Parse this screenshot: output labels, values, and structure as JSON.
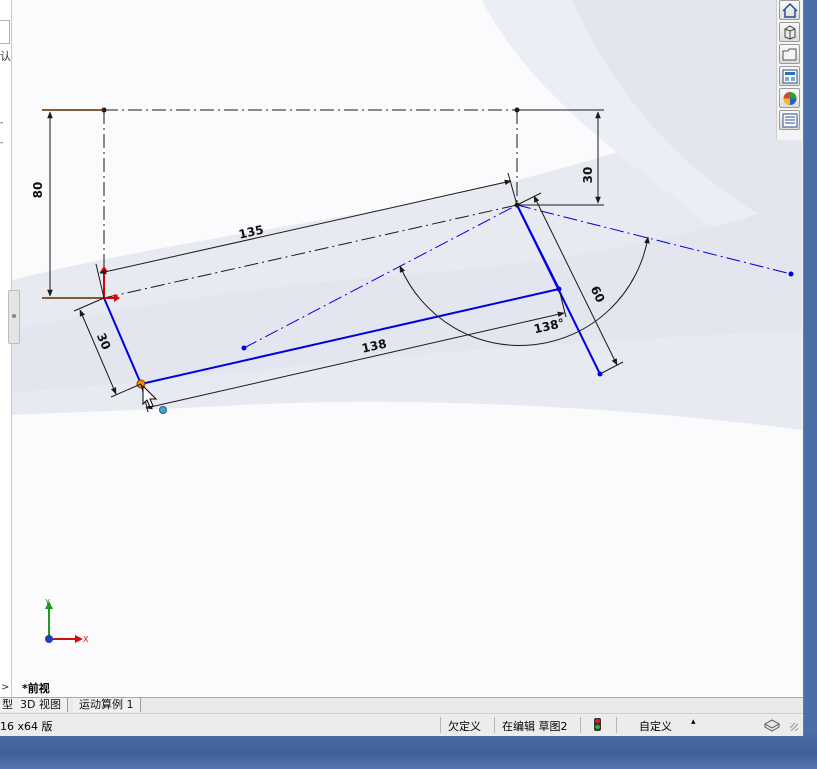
{
  "left_panel": {
    "fragments": [
      "认",
      "边"
    ]
  },
  "view_name": "*前视",
  "tabs": [
    {
      "label": "型"
    },
    {
      "label": "3D 视图"
    },
    {
      "label": "运动算例 1"
    }
  ],
  "status": {
    "version": "16 x64 版",
    "definition": "欠定义",
    "editing": "在编辑 草图2",
    "units": "自定义",
    "units_caret": "▴"
  },
  "right_toolbar": {
    "icons": [
      "home-icon",
      "3d-box-icon",
      "folder-icon",
      "view-palette-icon",
      "appearance-icon",
      "custom-properties-icon"
    ]
  },
  "colors": {
    "sketch_line": "#0000e0",
    "dimension": "#1a1a1a",
    "selected_point": "#ff8c00",
    "origin": "#e00000"
  },
  "sketch": {
    "dimensions": [
      "80",
      "30",
      "135",
      "30",
      "138",
      "60",
      "138°"
    ],
    "triad": {
      "x": "X",
      "y": "Y"
    }
  }
}
